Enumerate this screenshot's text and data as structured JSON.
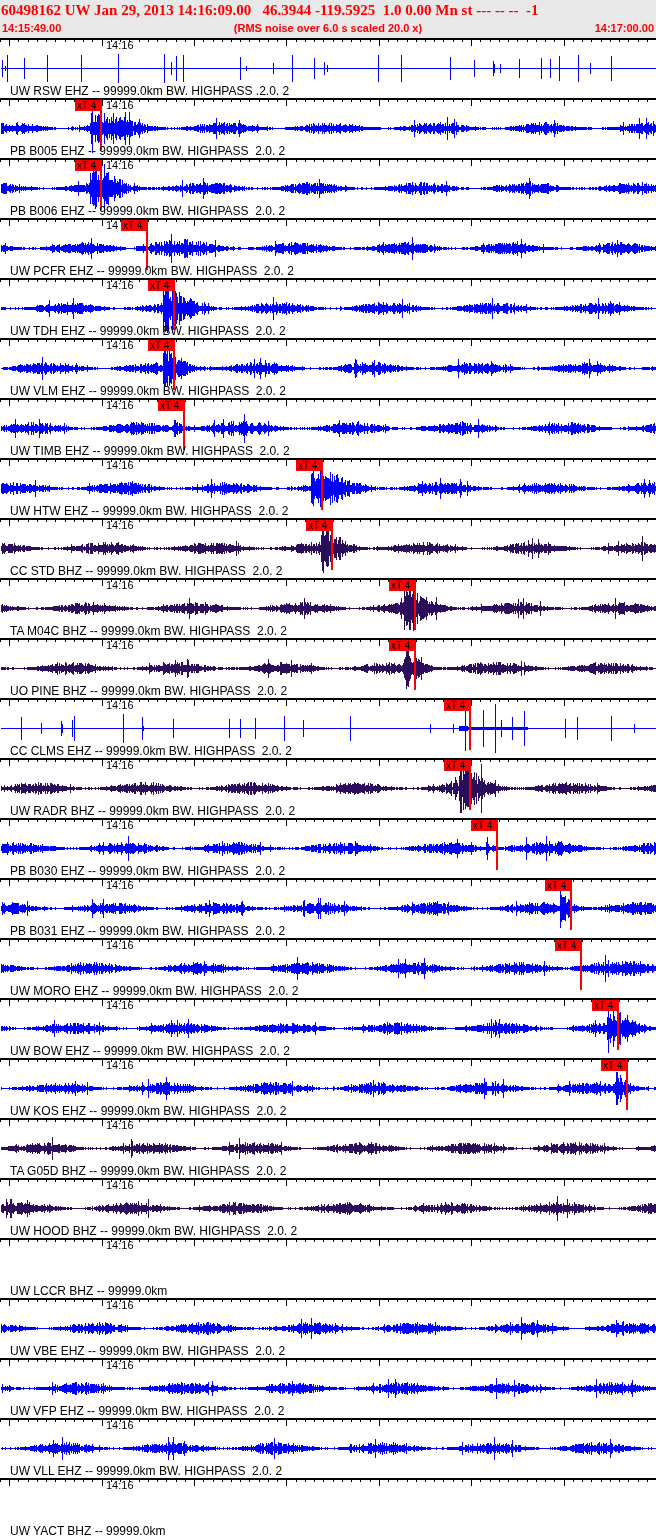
{
  "header": {
    "title": "60498162 UW Jan 29, 2013 14:16:09.00   46.3944 -119.5925  1.0 0.00 Mn st --- -- --  -1",
    "start_time": "14:15:49.00",
    "note": "(RMS noise over 6.0 s scaled 20.0 x)",
    "end_time": "14:17:00.00"
  },
  "traces": [
    {
      "kind": "spiky",
      "color": "#0000ff",
      "time_label": "14:16",
      "label": "UW RSW EHZ -- 99999.0km BW. HIGHPASS .2.0. 2"
    },
    {
      "kind": "noise",
      "color": "#0000ff",
      "time_label": "14:16",
      "pick": {
        "text": "xT 4"
      },
      "label": "PB B005 EHZ -- 99999.0km BW. HIGHPASS  2.0. 2"
    },
    {
      "kind": "noise",
      "color": "#0000ff",
      "time_label": "14:16",
      "pick": {
        "text": "xT 4"
      },
      "label": "PB B006 EHZ -- 99999.0km BW. HIGHPASS  2.0. 2"
    },
    {
      "kind": "noise",
      "color": "#0000ff",
      "time_label": "14",
      "pick": {
        "text": "xT 4"
      },
      "label": "UW PCFR EHZ -- 99999.0km BW. HIGHPASS  2.0. 2"
    },
    {
      "kind": "noise",
      "color": "#0000ff",
      "time_label": "14:16",
      "pick": {
        "text": "xT 4"
      },
      "label": "UW TDH EHZ -- 99999.0km BW. HIGHPASS  2.0. 2"
    },
    {
      "kind": "noise",
      "color": "#0000ff",
      "time_label": "14:16",
      "pick": {
        "text": "xT 4"
      },
      "label": "UW VLM EHZ -- 99999.0km BW. HIGHPASS  2.0. 2"
    },
    {
      "kind": "noise",
      "color": "#0000ff",
      "time_label": "14:16",
      "pick": {
        "text": "xT 4"
      },
      "label": "UW TIMB EHZ -- 99999.0km BW. HIGHPASS  2.0. 2"
    },
    {
      "kind": "noise",
      "color": "#0000ff",
      "time_label": "14:16",
      "pick": {
        "text": "xT 4"
      },
      "label": "UW HTW EHZ -- 99999.0km BW. HIGHPASS  2.0. 2"
    },
    {
      "kind": "noise",
      "color": "#2b0d5c",
      "time_label": "14:16",
      "pick": {
        "text": "xT 4"
      },
      "label": "CC STD BHZ -- 99999.0km BW. HIGHPASS  2.0. 2"
    },
    {
      "kind": "noise",
      "color": "#2b0d5c",
      "time_label": "14:16",
      "pick": {
        "text": "xT 4"
      },
      "label": "TA M04C BHZ -- 99999.0km BW. HIGHPASS  2.0. 2"
    },
    {
      "kind": "noise",
      "color": "#2b0d5c",
      "time_label": "14:16",
      "pick": {
        "text": "xT 4"
      },
      "label": "UO PINE BHZ -- 99999.0km BW. HIGHPASS  2.0. 2"
    },
    {
      "kind": "spiky",
      "color": "#0000ff",
      "time_label": "14:16",
      "pick": {
        "text": "xT 4"
      },
      "label": "CC CLMS EHZ -- 99999.0km BW. HIGHPASS  2.0. 2"
    },
    {
      "kind": "noise",
      "color": "#2b0d5c",
      "time_label": "14:16",
      "pick": {
        "text": "xT 4"
      },
      "label": "UW RADR BHZ -- 99999.0km BW. HIGHPASS  2.0. 2"
    },
    {
      "kind": "noise",
      "color": "#0000ff",
      "time_label": "14:16",
      "pick": {
        "text": "xT 4"
      },
      "label": "PB B030 EHZ -- 99999.0km BW. HIGHPASS  2.0. 2"
    },
    {
      "kind": "noise",
      "color": "#0000ff",
      "time_label": "14:16",
      "pick": {
        "text": "xT 4"
      },
      "label": "PB B031 EHZ -- 99999.0km BW. HIGHPASS  2.0. 2"
    },
    {
      "kind": "noise",
      "color": "#0000ff",
      "time_label": "14:16",
      "pick": {
        "text": "xT 4"
      },
      "label": "UW MORO EHZ -- 99999.0km BW. HIGHPASS  2.0. 2"
    },
    {
      "kind": "noise",
      "color": "#0000ff",
      "time_label": "14:16",
      "pick": {
        "text": "xT 4"
      },
      "label": "UW BOW EHZ -- 99999.0km BW. HIGHPASS  2.0. 2"
    },
    {
      "kind": "noise",
      "color": "#0000ff",
      "time_label": "14:16",
      "pick": {
        "text": "xT 4"
      },
      "label": "UW KOS EHZ -- 99999.0km BW. HIGHPASS  2.0. 2"
    },
    {
      "kind": "noise",
      "color": "#2b0d5c",
      "time_label": "14:16",
      "label": "TA G05D BHZ -- 99999.0km BW. HIGHPASS  2.0. 2"
    },
    {
      "kind": "noise",
      "color": "#2b0d5c",
      "time_label": "14:16",
      "label": "UW HOOD BHZ -- 99999.0km BW. HIGHPASS  2.0. 2"
    },
    {
      "kind": "blank",
      "time_label": "14:16",
      "label": "UW LCCR BHZ -- 99999.0km"
    },
    {
      "kind": "noise",
      "color": "#0000ff",
      "time_label": "14:16",
      "label": "UW VBE EHZ -- 99999.0km BW. HIGHPASS  2.0. 2"
    },
    {
      "kind": "noise",
      "color": "#0000ff",
      "time_label": "14:16",
      "label": "UW VFP EHZ -- 99999.0km BW. HIGHPASS  2.0. 2"
    },
    {
      "kind": "noise",
      "color": "#0000ff",
      "time_label": "14:16",
      "label": "UW VLL EHZ -- 99999.0km BW. HIGHPASS  2.0. 2"
    },
    {
      "kind": "blank",
      "time_label": "14:16",
      "label": "UW YACT BHZ -- 99999.0km"
    }
  ]
}
